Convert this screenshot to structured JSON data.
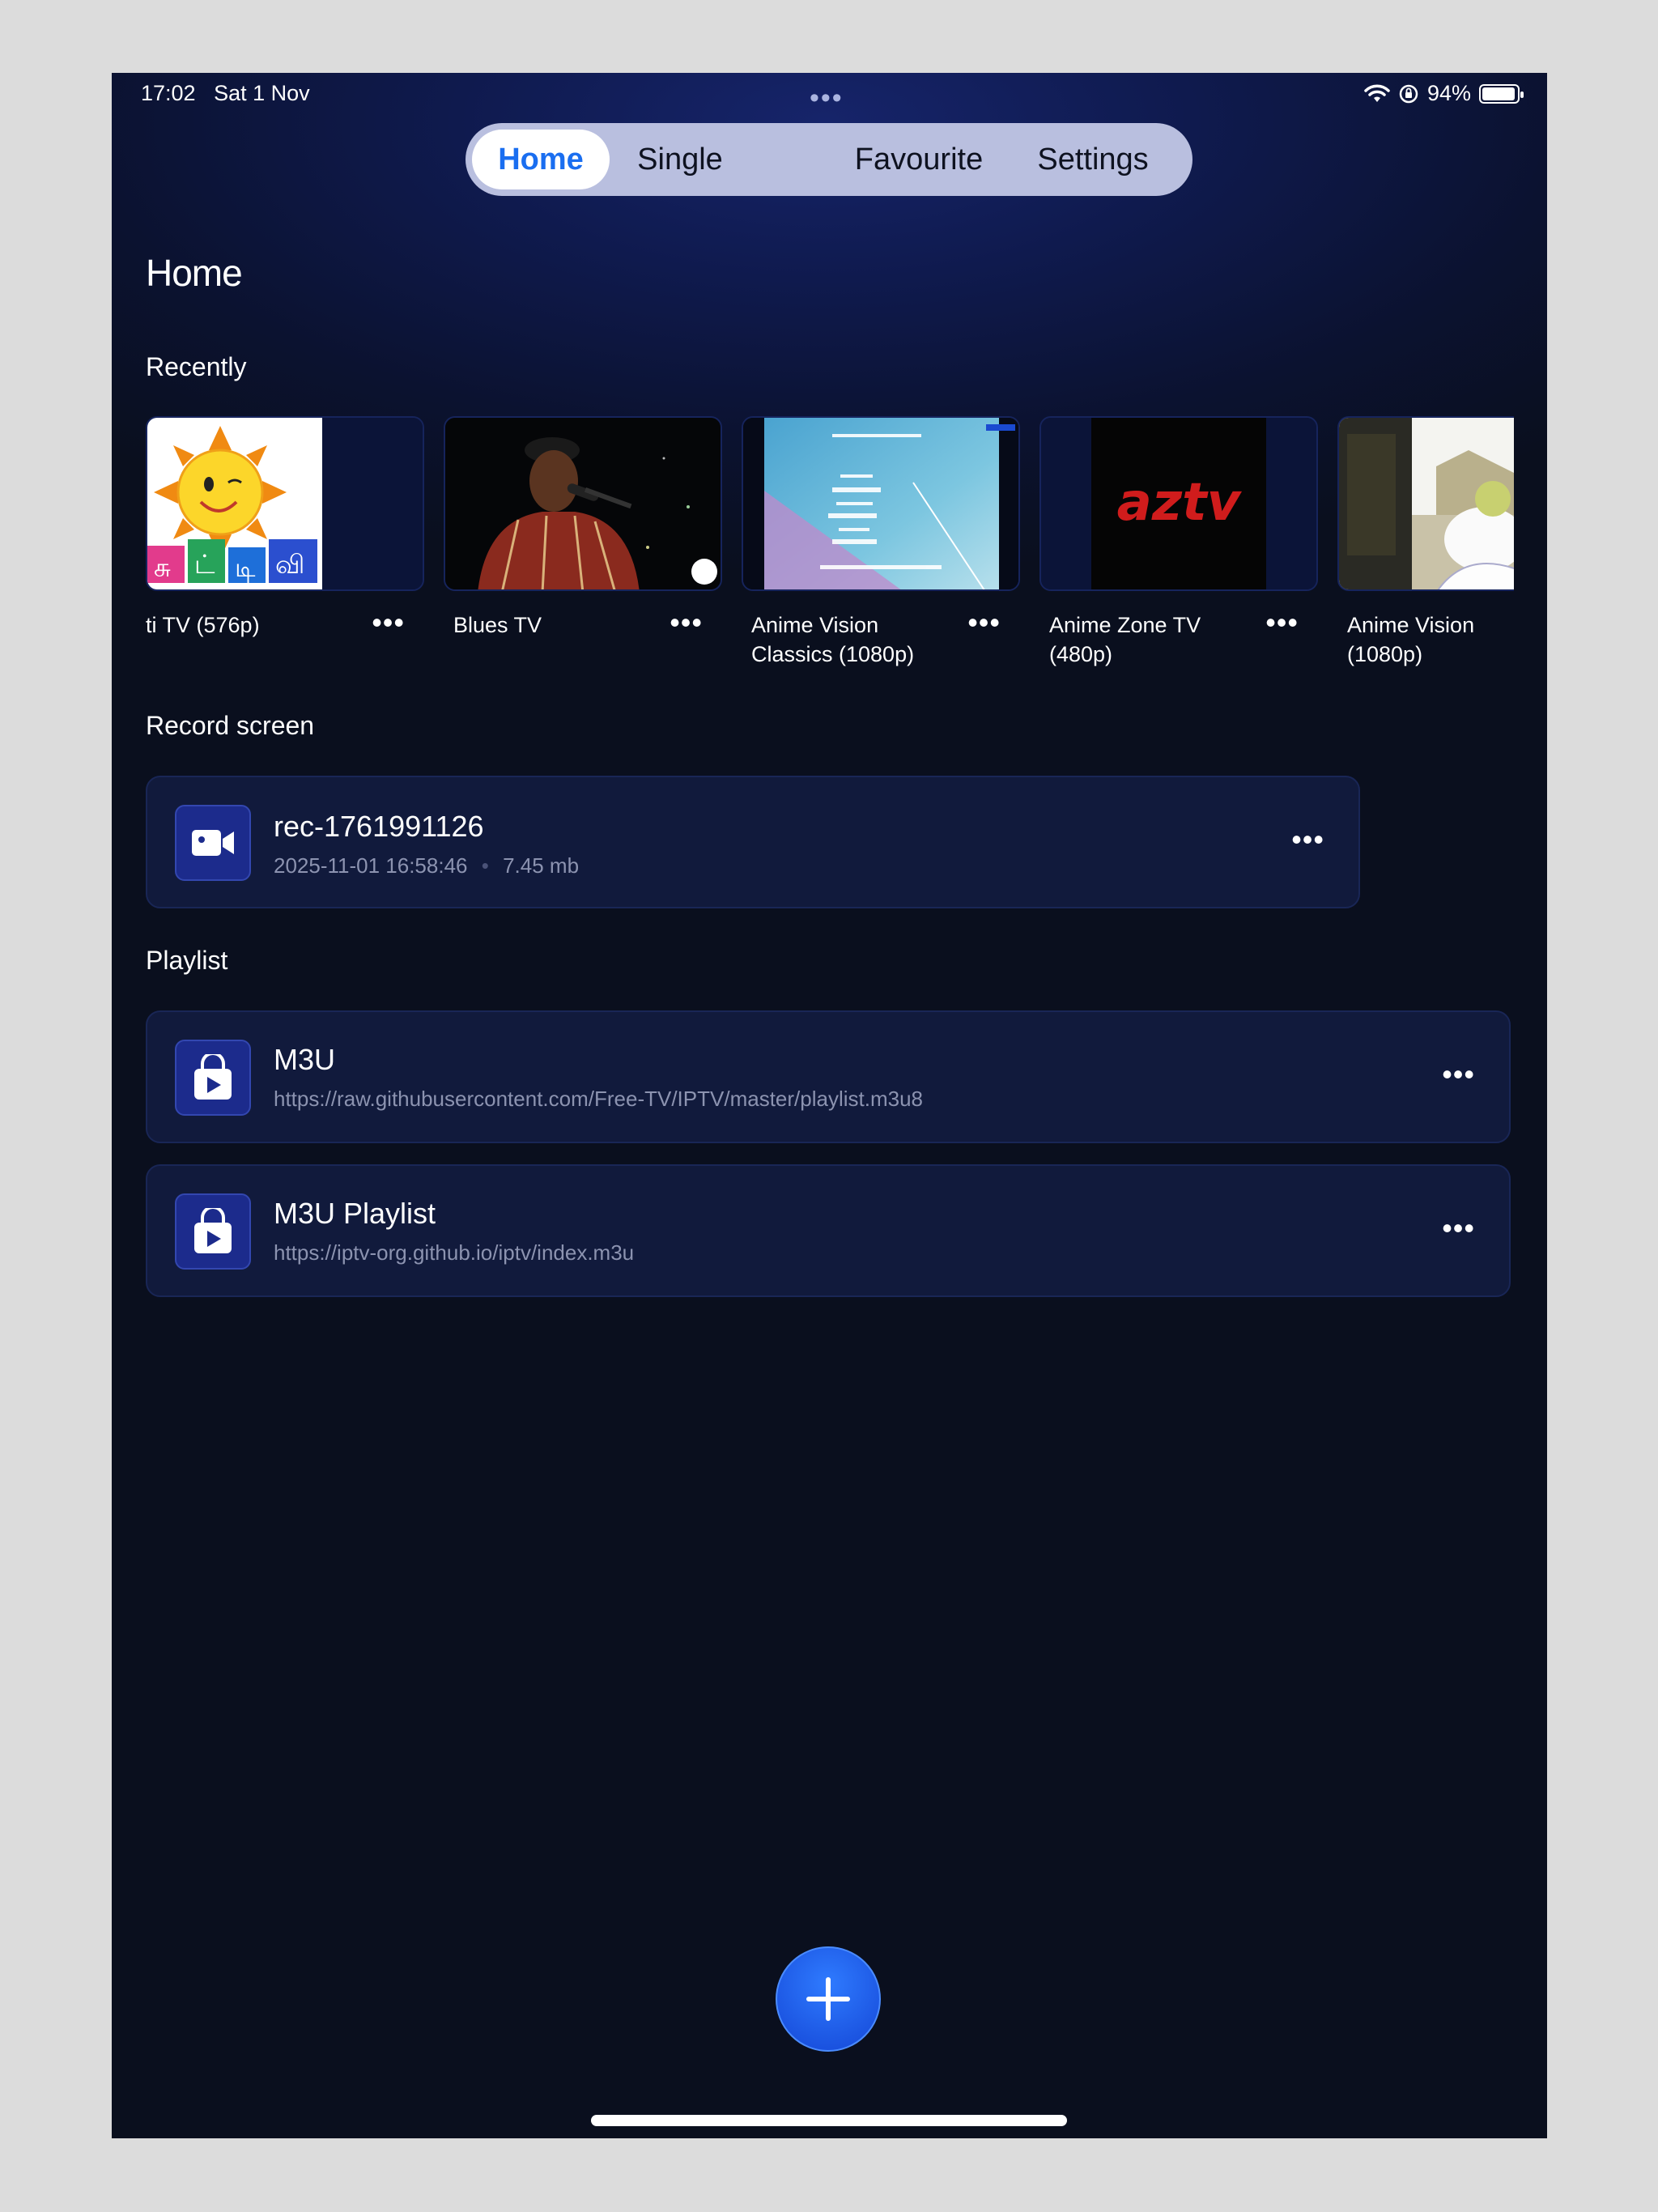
{
  "status": {
    "time": "17:02",
    "date": "Sat 1 Nov",
    "battery": "94%",
    "battery_level": 0.94
  },
  "tabs": [
    {
      "label": "Home",
      "active": true
    },
    {
      "label": "Single"
    },
    {
      "label": "Favourite"
    },
    {
      "label": "Settings"
    }
  ],
  "page": {
    "title": "Home"
  },
  "recently": {
    "title": "Recently",
    "items": [
      {
        "title": "ti TV (576p)"
      },
      {
        "title": "Blues TV"
      },
      {
        "title": "Anime Vision Classics (1080p)"
      },
      {
        "title": "Anime Zone TV (480p)"
      },
      {
        "title": "Anime Vision (1080p)"
      }
    ],
    "thumb_texts": {
      "az_logo": "aztv"
    }
  },
  "record": {
    "title": "Record screen",
    "items": [
      {
        "name": "rec-1761991126",
        "date": "2025-11-01 16:58:46",
        "size": "7.45 mb"
      }
    ]
  },
  "playlist": {
    "title": "Playlist",
    "items": [
      {
        "name": "M3U",
        "url": "https://raw.githubusercontent.com/Free-TV/IPTV/master/playlist.m3u8"
      },
      {
        "name": "M3U Playlist",
        "url": "https://iptv-org.github.io/iptv/index.m3u"
      }
    ]
  },
  "more_glyph": "•••",
  "colors": {
    "accent": "#1a6ef0",
    "background": "#0a0f1a",
    "card": "#111a3c",
    "icon_bg": "#1c2b8c"
  },
  "icons": [
    "wifi-icon",
    "orientation-lock-icon",
    "battery-icon",
    "video-camera-icon",
    "playlist-bag-icon",
    "plus-icon",
    "more-icon"
  ]
}
